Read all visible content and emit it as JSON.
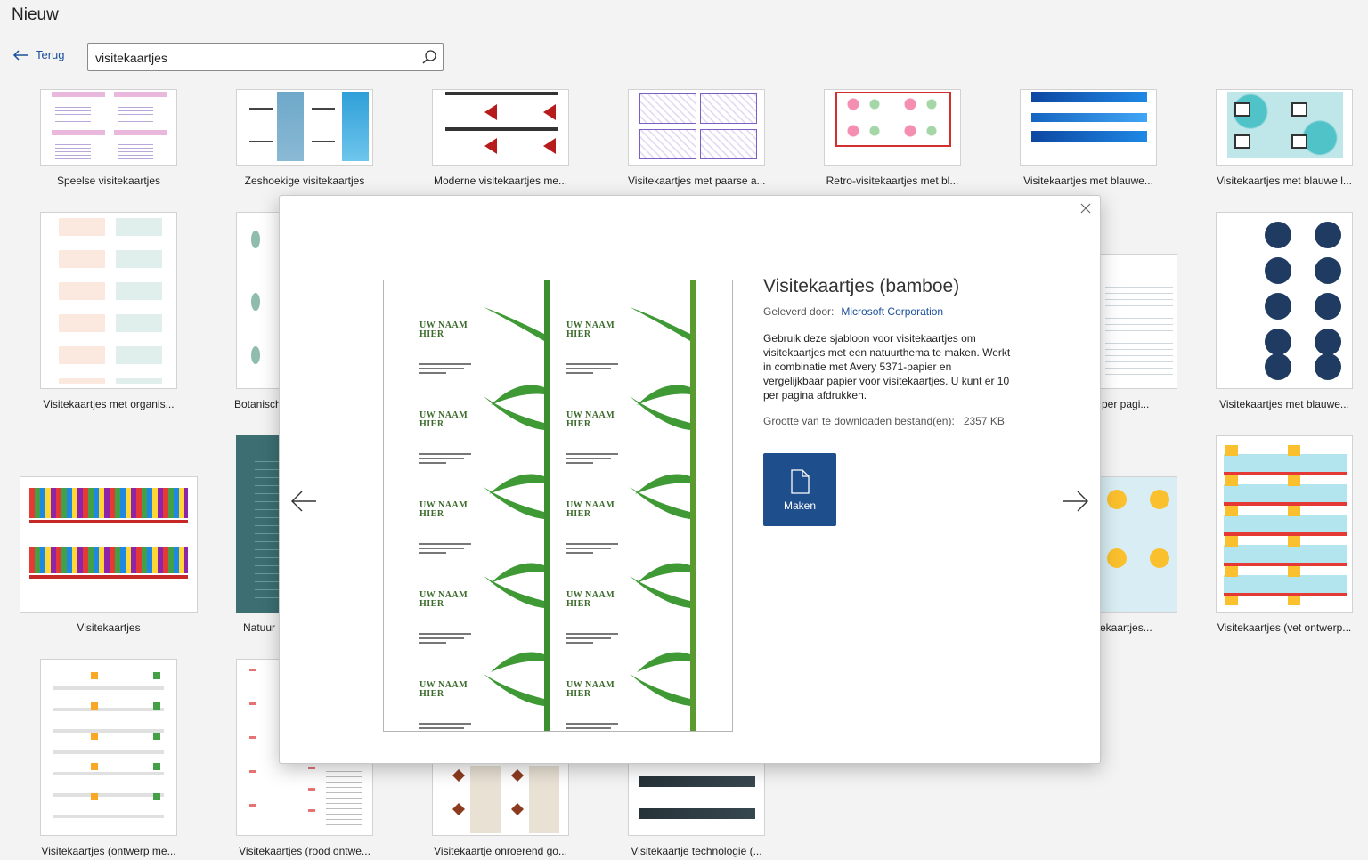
{
  "header": {
    "title": "Nieuw",
    "back_label": "Terug"
  },
  "search": {
    "value": "visitekaartjes"
  },
  "templates": [
    "Speelse visitekaartjes",
    "Zeshoekige visitekaartjes",
    "Moderne visitekaartjes me...",
    "Visitekaartjes met paarse a...",
    "Retro-visitekaartjes met bl...",
    "Visitekaartjes met blauwe...",
    "Visitekaartjes met blauwe l...",
    "Visitekaartjes met organis...",
    "Botanisch",
    "per pagi...",
    "Visitekaartjes met blauwe...",
    "Visitekaartjes",
    "Natuur",
    "ekaartjes...",
    "Visitekaartjes (vet ontwerp...",
    "Visitekaartjes (ontwerp me...",
    "Visitekaartjes (rood ontwe...",
    "Visitekaartje onroerend go...",
    "Visitekaartje technologie (..."
  ],
  "dialog": {
    "title": "Visitekaartjes (bamboe)",
    "provider_label": "Geleverd door:",
    "provider": "Microsoft Corporation",
    "description": "Gebruik deze sjabloon voor visitekaartjes om visitekaartjes met een natuurthema te maken. Werkt in combinatie met Avery 5371-papier en vergelijkbaar papier voor visitekaartjes. U kunt er 10 per pagina afdrukken.",
    "size_label": "Grootte van te downloaden bestand(en):",
    "size_value": "2357 KB",
    "make_label": "Maken",
    "preview_name_line1": "UW NAAM",
    "preview_name_line2": "HIER"
  },
  "colors": {
    "accent": "#1f4e8c",
    "link": "#1b4f9c",
    "bamboo": "#3b8f2e"
  },
  "icons": [
    "back-arrow-icon",
    "search-icon",
    "close-icon",
    "chevron-left-icon",
    "chevron-right-icon",
    "document-icon"
  ]
}
